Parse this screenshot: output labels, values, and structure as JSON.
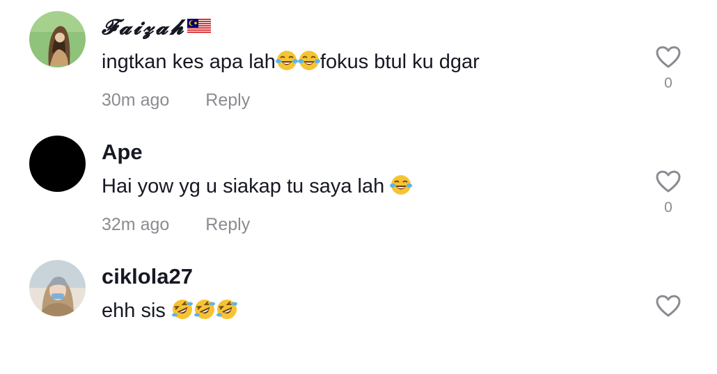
{
  "comments": [
    {
      "username": "𝓕𝓪𝓲𝔃𝓪𝓱",
      "text_before": "ingtkan kes apa lah",
      "emojis_mid": [
        "face-with-tears-of-joy",
        "face-with-tears-of-joy"
      ],
      "text_after": "fokus btul ku dgar",
      "time": "30m ago",
      "reply_label": "Reply",
      "likes": "0",
      "flag": "malaysia-flag"
    },
    {
      "username": "Ape",
      "text_before": "Hai yow yg u siakap tu saya lah ",
      "emojis_end": [
        "face-with-tears-of-joy"
      ],
      "time": "32m ago",
      "reply_label": "Reply",
      "likes": "0"
    },
    {
      "username": "ciklola27",
      "text_before": "ehh sis ",
      "emojis_end": [
        "rolling-on-the-floor-laughing",
        "rolling-on-the-floor-laughing",
        "rolling-on-the-floor-laughing"
      ]
    }
  ],
  "colors": {
    "primary_text": "#161823",
    "secondary_text": "#8a8b91",
    "emoji_yellow": "#f6c433",
    "emoji_tear": "#5ab4f0"
  }
}
